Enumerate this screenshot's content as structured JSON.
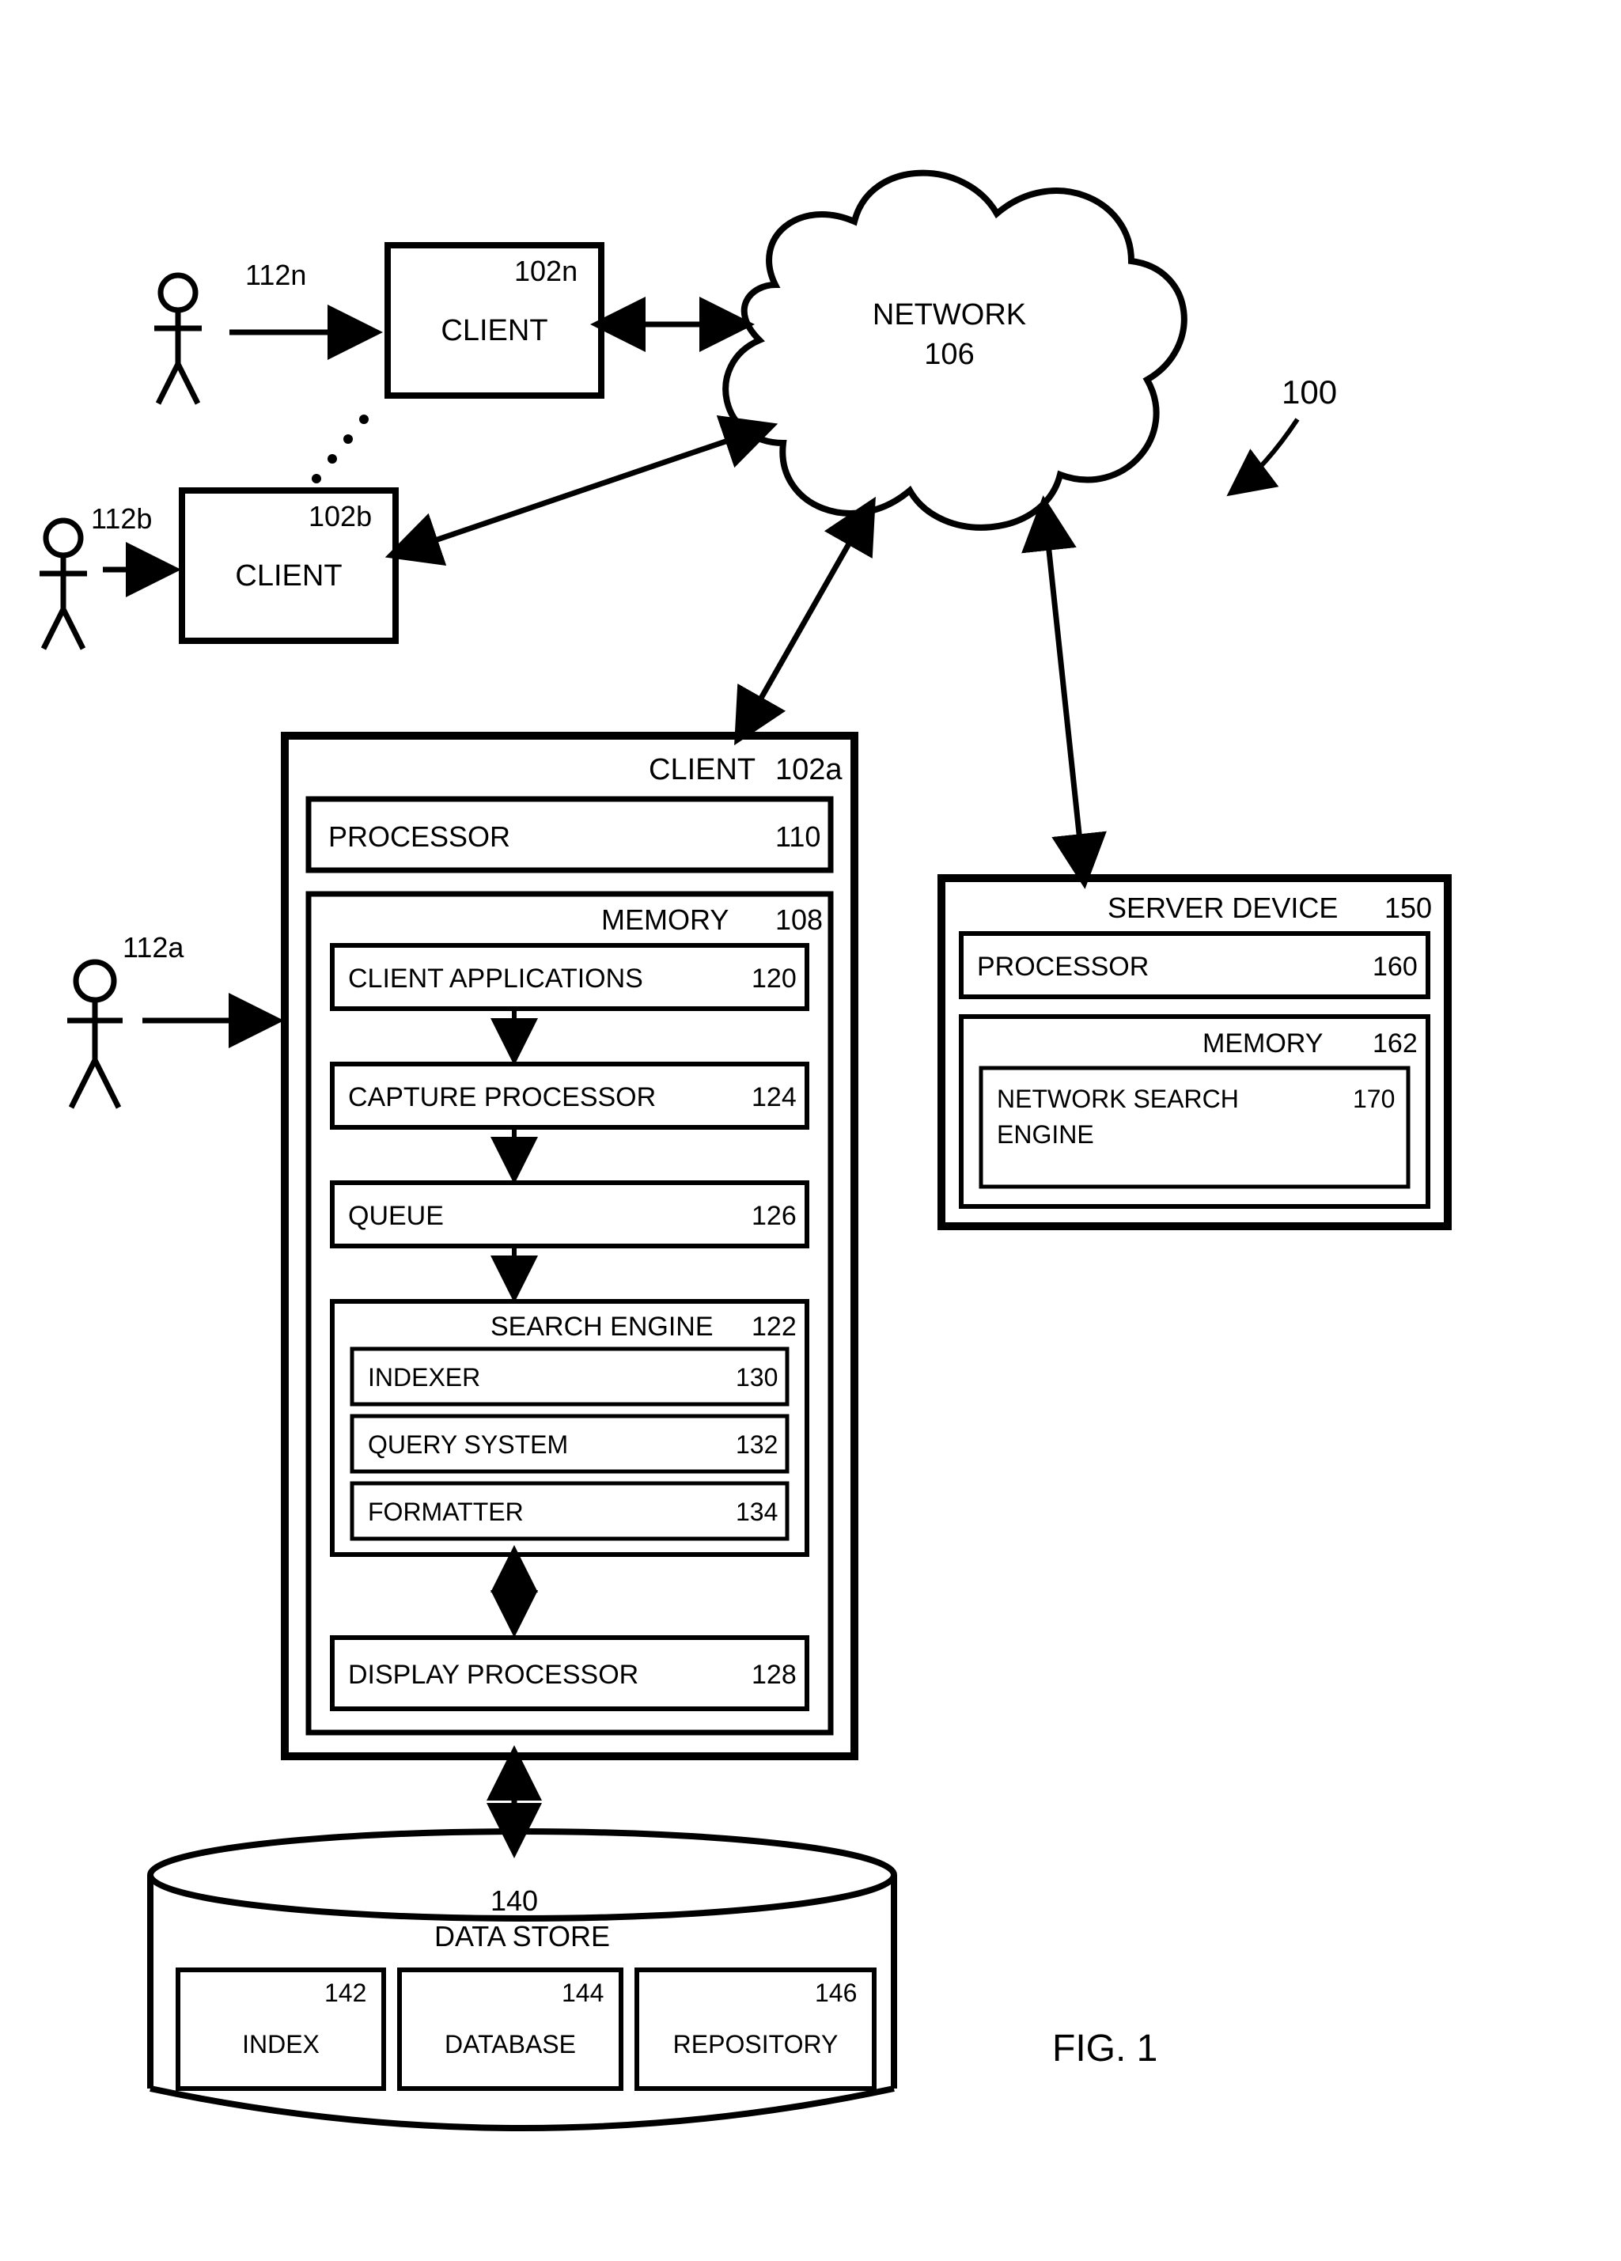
{
  "ids": {
    "system": "100",
    "user_n": "112n",
    "user_b": "112b",
    "user_a": "112a",
    "client_n": "102n",
    "client_b": "102b",
    "client_a": "102a",
    "network": "106",
    "processor": "110",
    "memory": "108",
    "client_apps": "120",
    "capture_proc": "124",
    "queue": "126",
    "search_engine": "122",
    "indexer": "130",
    "query_system": "132",
    "formatter": "134",
    "display_proc": "128",
    "data_store": "140",
    "index": "142",
    "database": "144",
    "repository": "146",
    "server_device": "150",
    "srv_processor": "160",
    "srv_memory": "162",
    "net_search_engine": "170"
  },
  "labels": {
    "network": "NETWORK",
    "client": "CLIENT",
    "processor": "PROCESSOR",
    "memory": "MEMORY",
    "client_apps": "CLIENT APPLICATIONS",
    "capture_proc": "CAPTURE PROCESSOR",
    "queue": "QUEUE",
    "search_engine": "SEARCH ENGINE",
    "indexer": "INDEXER",
    "query_system": "QUERY SYSTEM",
    "formatter": "FORMATTER",
    "display_proc": "DISPLAY PROCESSOR",
    "data_store": "DATA STORE",
    "index": "INDEX",
    "database": "DATABASE",
    "repository": "REPOSITORY",
    "server_device": "SERVER DEVICE",
    "net_search_engine_l1": "NETWORK SEARCH",
    "net_search_engine_l2": "ENGINE"
  },
  "figure": "FIG. 1"
}
